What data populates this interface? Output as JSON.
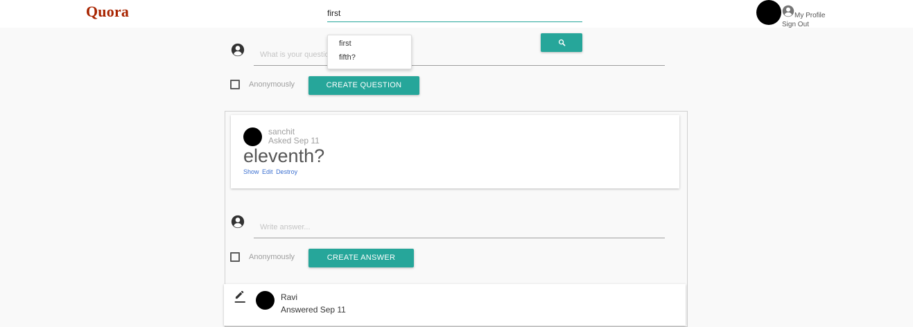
{
  "header": {
    "logo": "Quora",
    "search": {
      "value": "first",
      "placeholder": ""
    },
    "search_button_icon": "search-icon",
    "profile_link": "My Profile",
    "sign_out_link": "Sign Out"
  },
  "autocomplete": {
    "items": [
      "first",
      "fifth?"
    ]
  },
  "ask_form": {
    "placeholder": "What is your question?",
    "anonymous_label": "Anonymously",
    "submit_label": "CREATE QUESTION"
  },
  "question": {
    "author": "sanchit",
    "date": "Asked Sep 11",
    "title": "eleventh?",
    "actions": [
      "Show",
      "Edit",
      "Destroy"
    ]
  },
  "answer_form": {
    "placeholder": "Write answer...",
    "anonymous_label": "Anonymously",
    "submit_label": "CREATE ANSWER"
  },
  "answer": {
    "author": "Ravi",
    "date": "Answered Sep 11"
  },
  "colors": {
    "accent": "#26a69a",
    "logo": "#a82400",
    "link": "#3b6fd0"
  }
}
